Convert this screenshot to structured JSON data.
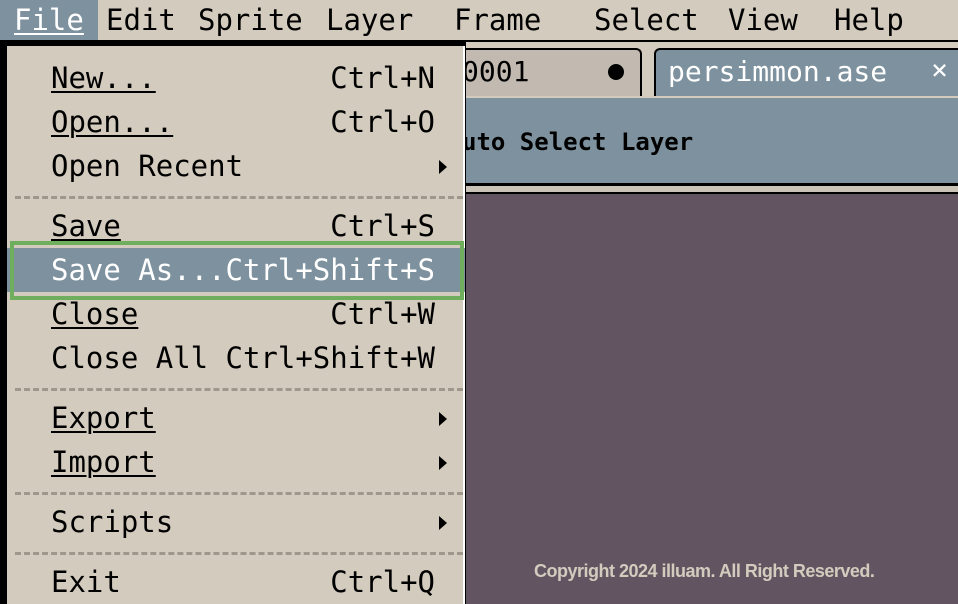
{
  "menubar": {
    "items": [
      {
        "label": "File",
        "active": true
      },
      {
        "label": "Edit"
      },
      {
        "label": "Sprite"
      },
      {
        "label": "Layer"
      },
      {
        "label": "Frame"
      },
      {
        "label": "Select"
      },
      {
        "label": "View"
      },
      {
        "label": "Help"
      }
    ]
  },
  "tabs": {
    "inactive_label": "0001",
    "active_label": "persimmon.ase",
    "close_glyph": "×"
  },
  "toolbar": {
    "text": "uto Select Layer"
  },
  "file_menu": {
    "items": [
      {
        "label": "New...",
        "shortcut": "Ctrl+N"
      },
      {
        "label": "Open...",
        "shortcut": "Ctrl+O"
      },
      {
        "label": "Open Recent",
        "submenu": true
      },
      {
        "label": "Save",
        "shortcut": "Ctrl+S"
      },
      {
        "label": "Save As...",
        "shortcut": "Ctrl+Shift+S",
        "selected": true
      },
      {
        "label": "Close",
        "shortcut": "Ctrl+W"
      },
      {
        "label": "Close All",
        "shortcut": "Ctrl+Shift+W"
      },
      {
        "label": "Export",
        "submenu": true
      },
      {
        "label": "Import",
        "submenu": true
      },
      {
        "label": "Scripts",
        "submenu": true
      },
      {
        "label": "Exit",
        "shortcut": "Ctrl+Q"
      }
    ]
  },
  "footer": {
    "copyright": "Copyright 2024 illuam. All Right Reserved."
  },
  "colors": {
    "menu_bg": "#d3cbbe",
    "accent": "#7d929e",
    "canvas": "#625561",
    "highlight": "#6fae5d"
  }
}
